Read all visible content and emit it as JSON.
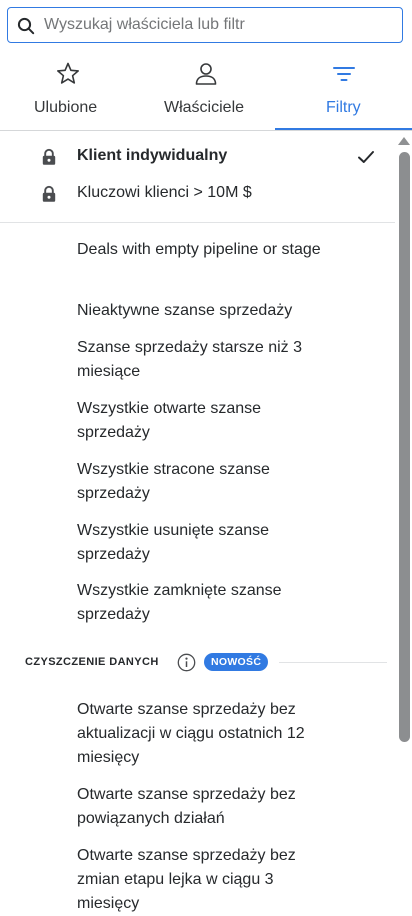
{
  "search": {
    "placeholder": "Wyszukaj właściciela lub filtr",
    "value": ""
  },
  "tabs": [
    {
      "label": "Ulubione",
      "icon": "star-icon",
      "active": false
    },
    {
      "label": "Właściciele",
      "icon": "person-icon",
      "active": false
    },
    {
      "label": "Filtry",
      "icon": "filter-icon",
      "active": true
    }
  ],
  "locked_filters": [
    {
      "label": "Klient indywidualny",
      "selected": true,
      "icon": "lock-icon"
    },
    {
      "label": "Kluczowi klienci > 10M $",
      "selected": false,
      "icon": "lock-icon"
    }
  ],
  "filters": [
    "Deals with empty pipeline or stage",
    "Nieaktywne szanse sprzedaży",
    "Szanse sprzedaży starsze niż 3 miesiące",
    "Wszystkie otwarte szanse sprzedaży",
    "Wszystkie stracone szanse sprzedaży",
    "Wszystkie usunięte szanse sprzedaży",
    "Wszystkie zamknięte szanse sprzedaży"
  ],
  "data_cleanup": {
    "title": "CZYSZCZENIE DANYCH",
    "badge": "NOWOŚĆ",
    "items": [
      "Otwarte szanse sprzedaży bez aktualizacji w ciągu ostatnich 12 miesięcy",
      "Otwarte szanse sprzedaży bez powiązanych działań",
      "Otwarte szanse sprzedaży bez zmian etapu lejka w ciągu 3 miesięcy"
    ]
  },
  "colors": {
    "accent": "#317ae2",
    "text": "#26292c",
    "muted": "#747678"
  }
}
